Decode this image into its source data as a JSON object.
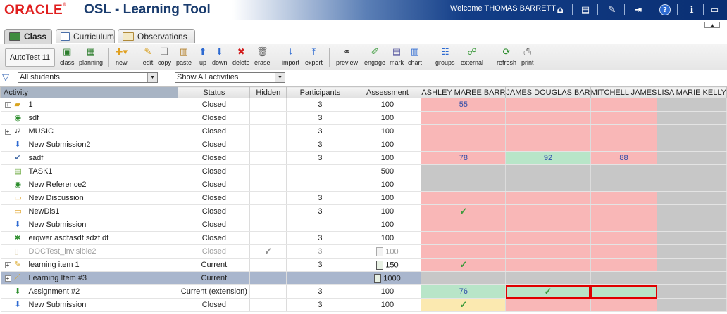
{
  "header": {
    "brand": "ORACLE",
    "app_title": "OSL - Learning Tool",
    "welcome": "Welcome THOMAS BARRETT"
  },
  "tabs": [
    {
      "label": "Class",
      "active": true
    },
    {
      "label": "Curriculum",
      "active": false
    },
    {
      "label": "Observations",
      "active": false
    }
  ],
  "toolbar": {
    "class_selector": "AutoTest 11",
    "buttons": {
      "class": "class",
      "planning": "planning",
      "new": "new",
      "edit": "edit",
      "copy": "copy",
      "paste": "paste",
      "up": "up",
      "down": "down",
      "delete": "delete",
      "erase": "erase",
      "import": "import",
      "export": "export",
      "preview": "preview",
      "engage": "engage",
      "mark": "mark",
      "chart": "chart",
      "groups": "groups",
      "external": "external",
      "refresh": "refresh",
      "print": "print"
    }
  },
  "filters": {
    "students": "All students",
    "activities": "Show All activities"
  },
  "grid": {
    "columns": {
      "activity": "Activity",
      "status": "Status",
      "hidden": "Hidden",
      "participants": "Participants",
      "assessment": "Assessment",
      "student1": "ASHLEY MAREE BARR",
      "student2": "JAMES DOUGLAS BAR",
      "student3": "MITCHELL JAMES",
      "student4": "LISA MARIE KELLY"
    },
    "rows": [
      {
        "name": "1",
        "status": "Closed",
        "participants": "3",
        "assessment": "100",
        "s1": "55",
        "s2": "",
        "s3": "",
        "s4": ""
      },
      {
        "name": "sdf",
        "status": "Closed",
        "participants": "3",
        "assessment": "100",
        "s1": "",
        "s2": "",
        "s3": "",
        "s4": ""
      },
      {
        "name": "MUSIC",
        "status": "Closed",
        "participants": "3",
        "assessment": "100",
        "s1": "",
        "s2": "",
        "s3": "",
        "s4": ""
      },
      {
        "name": "New Submission2",
        "status": "Closed",
        "participants": "3",
        "assessment": "100",
        "s1": "",
        "s2": "",
        "s3": "",
        "s4": ""
      },
      {
        "name": "sadf",
        "status": "Closed",
        "participants": "3",
        "assessment": "100",
        "s1": "78",
        "s2": "92",
        "s3": "88",
        "s4": ""
      },
      {
        "name": "TASK1",
        "status": "Closed",
        "participants": "",
        "assessment": "500",
        "s1": "",
        "s2": "",
        "s3": "",
        "s4": ""
      },
      {
        "name": "New Reference2",
        "status": "Closed",
        "participants": "",
        "assessment": "100",
        "s1": "",
        "s2": "",
        "s3": "",
        "s4": ""
      },
      {
        "name": "New Discussion",
        "status": "Closed",
        "participants": "3",
        "assessment": "100",
        "s1": "",
        "s2": "",
        "s3": "",
        "s4": ""
      },
      {
        "name": "NewDis1",
        "status": "Closed",
        "participants": "3",
        "assessment": "100",
        "s1": "",
        "s2": "",
        "s3": "",
        "s4": ""
      },
      {
        "name": "New Submission",
        "status": "Closed",
        "participants": "",
        "assessment": "100",
        "s1": "",
        "s2": "",
        "s3": "",
        "s4": ""
      },
      {
        "name": "erqwer asdfasdf sdzf df",
        "status": "Closed",
        "participants": "3",
        "assessment": "100",
        "s1": "",
        "s2": "",
        "s3": "",
        "s4": ""
      },
      {
        "name": "DOCTest_invisible2",
        "status": "Closed",
        "participants": "3",
        "assessment": "100",
        "s1": "",
        "s2": "",
        "s3": "",
        "s4": ""
      },
      {
        "name": "learning item 1",
        "status": "Current",
        "participants": "3",
        "assessment": "150",
        "s1": "",
        "s2": "",
        "s3": "",
        "s4": ""
      },
      {
        "name": "Learning Item #3",
        "status": "Current",
        "participants": "",
        "assessment": "1000",
        "s1": "",
        "s2": "",
        "s3": "",
        "s4": ""
      },
      {
        "name": "Assignment #2",
        "status": "Current (extension)",
        "participants": "3",
        "assessment": "100",
        "s1": "76",
        "s2": "",
        "s3": "",
        "s4": ""
      },
      {
        "name": "New Submission",
        "status": "Closed",
        "participants": "3",
        "assessment": "100",
        "s1": "",
        "s2": "",
        "s3": "",
        "s4": ""
      }
    ]
  },
  "colors": {
    "incomplete": "#f9b7b7",
    "not_assigned": "#c7c7c7",
    "marked": "#b8e5c8",
    "pending": "#fbe9b0",
    "selected_row": "#a9b6cd",
    "brand_red": "#e01e1e"
  }
}
